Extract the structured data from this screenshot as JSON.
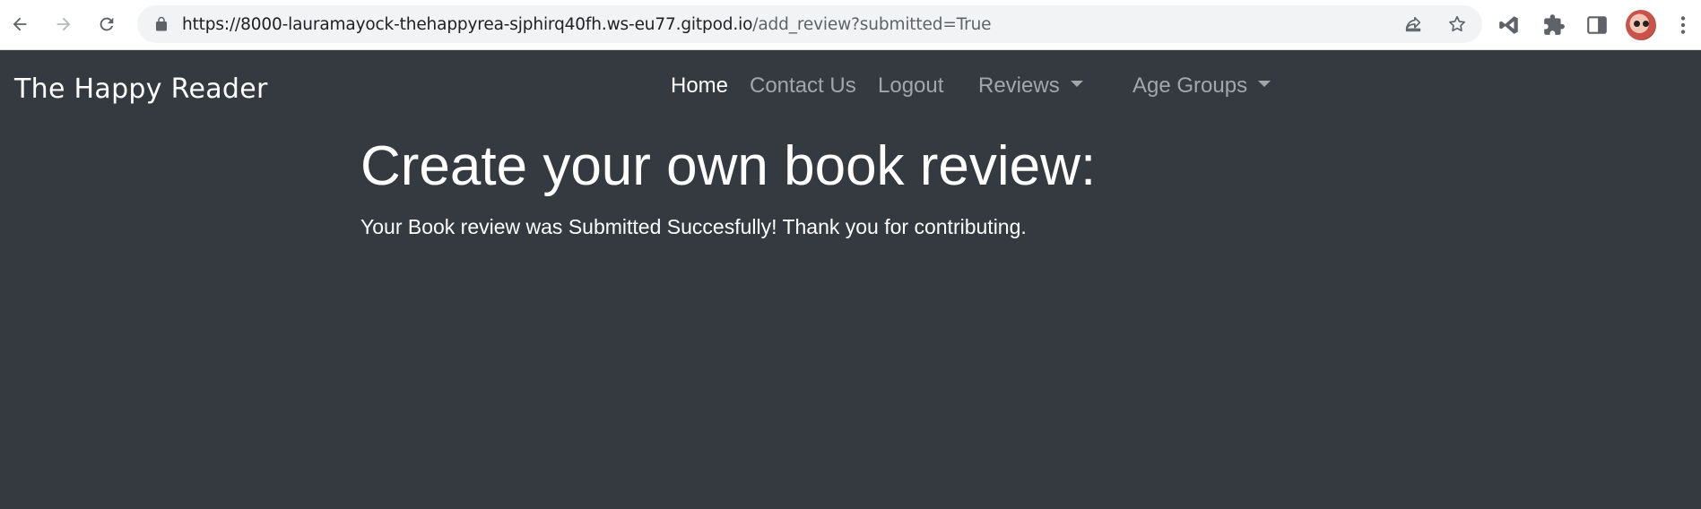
{
  "browser": {
    "url_host": "https://8000-lauramayock-thehappyrea-sjphirq40fh.ws-eu77.gitpod.io",
    "url_path": "/add_review?submitted=True",
    "icons": [
      "back-icon",
      "forward-icon",
      "reload-icon",
      "lock-icon",
      "share-icon",
      "star-icon",
      "vscode-icon",
      "extensions-icon",
      "side-panel-icon",
      "profile-avatar",
      "menu-icon"
    ]
  },
  "navbar": {
    "brand": "The Happy Reader",
    "links": {
      "home": "Home",
      "contact": "Contact Us",
      "logout": "Logout",
      "reviews": "Reviews",
      "age_groups": "Age Groups"
    }
  },
  "main": {
    "title": "Create your own book review:",
    "message": "Your Book review was Submitted Succesfully! Thank you for contributing."
  },
  "colors": {
    "page_bg": "#343a40",
    "text_primary": "#ffffff",
    "nav_muted": "rgba(255,255,255,0.55)"
  }
}
